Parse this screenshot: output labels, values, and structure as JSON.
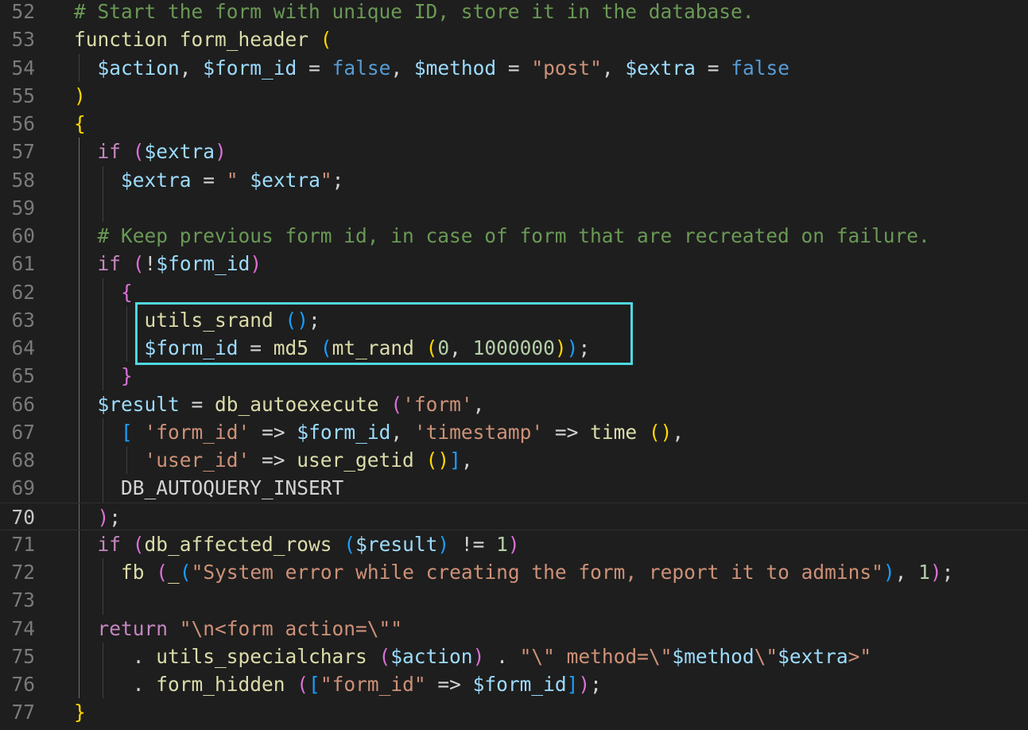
{
  "editor": {
    "colors": {
      "background": "#1e1e1e",
      "line_number": "#7a7a7a",
      "line_number_active": "#c6c6c6",
      "highlight_box": "#4fd8e0",
      "comment": "#6a9955",
      "keyword": "#c586c0",
      "function": "#dcdcaa",
      "variable": "#9cdcfe",
      "string": "#ce9178",
      "number": "#b5cea8",
      "plain": "#d4d4d4",
      "boolean": "#569cd6",
      "bracket_1": "#ffd700",
      "bracket_2": "#da70d6",
      "bracket_3": "#179fff"
    },
    "active_line": "70",
    "lines": [
      {
        "num": "52",
        "tokens": [
          [
            "cm",
            "# Start the form with unique ID, store it in the database."
          ]
        ]
      },
      {
        "num": "53",
        "tokens": [
          [
            "fn",
            "function form_header "
          ],
          [
            "b1",
            "("
          ]
        ]
      },
      {
        "num": "54",
        "tokens": [
          [
            "pl",
            "  "
          ],
          [
            "vr",
            "$action"
          ],
          [
            "pl",
            ", "
          ],
          [
            "vr",
            "$form_id"
          ],
          [
            "pl",
            " = "
          ],
          [
            "bl",
            "false"
          ],
          [
            "pl",
            ", "
          ],
          [
            "vr",
            "$method"
          ],
          [
            "pl",
            " = "
          ],
          [
            "st",
            "\"post\""
          ],
          [
            "pl",
            ", "
          ],
          [
            "vr",
            "$extra"
          ],
          [
            "pl",
            " = "
          ],
          [
            "bl",
            "false"
          ]
        ]
      },
      {
        "num": "55",
        "tokens": [
          [
            "b1",
            ")"
          ]
        ]
      },
      {
        "num": "56",
        "tokens": [
          [
            "b1",
            "{"
          ]
        ]
      },
      {
        "num": "57",
        "tokens": [
          [
            "pl",
            "  "
          ],
          [
            "kw",
            "if "
          ],
          [
            "b2",
            "("
          ],
          [
            "vr",
            "$extra"
          ],
          [
            "b2",
            ")"
          ]
        ]
      },
      {
        "num": "58",
        "tokens": [
          [
            "pl",
            "    "
          ],
          [
            "vr",
            "$extra"
          ],
          [
            "pl",
            " = "
          ],
          [
            "st",
            "\" "
          ],
          [
            "vr",
            "$extra"
          ],
          [
            "st",
            "\""
          ],
          [
            "pl",
            ";"
          ]
        ]
      },
      {
        "num": "59",
        "tokens": []
      },
      {
        "num": "60",
        "tokens": [
          [
            "pl",
            "  "
          ],
          [
            "cm",
            "# Keep previous form id, in case of form that are recreated on failure."
          ]
        ]
      },
      {
        "num": "61",
        "tokens": [
          [
            "pl",
            "  "
          ],
          [
            "kw",
            "if "
          ],
          [
            "b2",
            "("
          ],
          [
            "pl",
            "!"
          ],
          [
            "vr",
            "$form_id"
          ],
          [
            "b2",
            ")"
          ]
        ]
      },
      {
        "num": "62",
        "tokens": [
          [
            "pl",
            "    "
          ],
          [
            "b2",
            "{"
          ]
        ]
      },
      {
        "num": "63",
        "tokens": [
          [
            "pl",
            "      "
          ],
          [
            "fn",
            "utils_srand "
          ],
          [
            "b3",
            "()"
          ],
          [
            "pl",
            ";"
          ]
        ]
      },
      {
        "num": "64",
        "tokens": [
          [
            "pl",
            "      "
          ],
          [
            "vr",
            "$form_id"
          ],
          [
            "pl",
            " = "
          ],
          [
            "fn",
            "md5 "
          ],
          [
            "b3",
            "("
          ],
          [
            "fn",
            "mt_rand "
          ],
          [
            "b1",
            "("
          ],
          [
            "nm",
            "0"
          ],
          [
            "pl",
            ", "
          ],
          [
            "nm",
            "1000000"
          ],
          [
            "b1",
            ")"
          ],
          [
            "b3",
            ")"
          ],
          [
            "pl",
            ";"
          ]
        ]
      },
      {
        "num": "65",
        "tokens": [
          [
            "pl",
            "    "
          ],
          [
            "b2",
            "}"
          ]
        ]
      },
      {
        "num": "66",
        "tokens": [
          [
            "pl",
            "  "
          ],
          [
            "vr",
            "$result"
          ],
          [
            "pl",
            " = "
          ],
          [
            "fn",
            "db_autoexecute "
          ],
          [
            "b2",
            "("
          ],
          [
            "st",
            "'form'"
          ],
          [
            "pl",
            ","
          ]
        ]
      },
      {
        "num": "67",
        "tokens": [
          [
            "pl",
            "    "
          ],
          [
            "b3",
            "["
          ],
          [
            "pl",
            " "
          ],
          [
            "st",
            "'form_id'"
          ],
          [
            "pl",
            " => "
          ],
          [
            "vr",
            "$form_id"
          ],
          [
            "pl",
            ", "
          ],
          [
            "st",
            "'timestamp'"
          ],
          [
            "pl",
            " => "
          ],
          [
            "fn",
            "time "
          ],
          [
            "b1",
            "()"
          ],
          [
            "pl",
            ","
          ]
        ]
      },
      {
        "num": "68",
        "tokens": [
          [
            "pl",
            "      "
          ],
          [
            "st",
            "'user_id'"
          ],
          [
            "pl",
            " => "
          ],
          [
            "fn",
            "user_getid "
          ],
          [
            "b1",
            "()"
          ],
          [
            "b3",
            "]"
          ],
          [
            "pl",
            ","
          ]
        ]
      },
      {
        "num": "69",
        "tokens": [
          [
            "pl",
            "    "
          ],
          [
            "pl",
            "DB_AUTOQUERY_INSERT"
          ]
        ]
      },
      {
        "num": "70",
        "tokens": [
          [
            "pl",
            "  "
          ],
          [
            "b2",
            ")"
          ],
          [
            "pl",
            ";"
          ]
        ]
      },
      {
        "num": "71",
        "tokens": [
          [
            "pl",
            "  "
          ],
          [
            "kw",
            "if "
          ],
          [
            "b2",
            "("
          ],
          [
            "fn",
            "db_affected_rows "
          ],
          [
            "b3",
            "("
          ],
          [
            "vr",
            "$result"
          ],
          [
            "b3",
            ")"
          ],
          [
            "pl",
            " != "
          ],
          [
            "nm",
            "1"
          ],
          [
            "b2",
            ")"
          ]
        ]
      },
      {
        "num": "72",
        "tokens": [
          [
            "pl",
            "    "
          ],
          [
            "fn",
            "fb "
          ],
          [
            "b2",
            "("
          ],
          [
            "fn",
            "_"
          ],
          [
            "b3",
            "("
          ],
          [
            "st",
            "\"System error while creating the form, report it to admins\""
          ],
          [
            "b3",
            ")"
          ],
          [
            "pl",
            ", "
          ],
          [
            "nm",
            "1"
          ],
          [
            "b2",
            ")"
          ],
          [
            "pl",
            ";"
          ]
        ]
      },
      {
        "num": "73",
        "tokens": []
      },
      {
        "num": "74",
        "tokens": [
          [
            "pl",
            "  "
          ],
          [
            "kw",
            "return "
          ],
          [
            "st",
            "\"\\n<form action=\\\"\""
          ]
        ]
      },
      {
        "num": "75",
        "tokens": [
          [
            "pl",
            "     . "
          ],
          [
            "fn",
            "utils_specialchars "
          ],
          [
            "b2",
            "("
          ],
          [
            "vr",
            "$action"
          ],
          [
            "b2",
            ")"
          ],
          [
            "pl",
            " . "
          ],
          [
            "st",
            "\"\\\" method=\\\""
          ],
          [
            "vr",
            "$method"
          ],
          [
            "st",
            "\\\""
          ],
          [
            "vr",
            "$extra"
          ],
          [
            "st",
            ">\""
          ]
        ]
      },
      {
        "num": "76",
        "tokens": [
          [
            "pl",
            "     . "
          ],
          [
            "fn",
            "form_hidden "
          ],
          [
            "b2",
            "("
          ],
          [
            "b3",
            "["
          ],
          [
            "st",
            "\"form_id\""
          ],
          [
            "pl",
            " => "
          ],
          [
            "vr",
            "$form_id"
          ],
          [
            "b3",
            "]"
          ],
          [
            "b2",
            ")"
          ],
          [
            "pl",
            ";"
          ]
        ]
      },
      {
        "num": "77",
        "tokens": [
          [
            "b1",
            "}"
          ]
        ]
      }
    ]
  }
}
